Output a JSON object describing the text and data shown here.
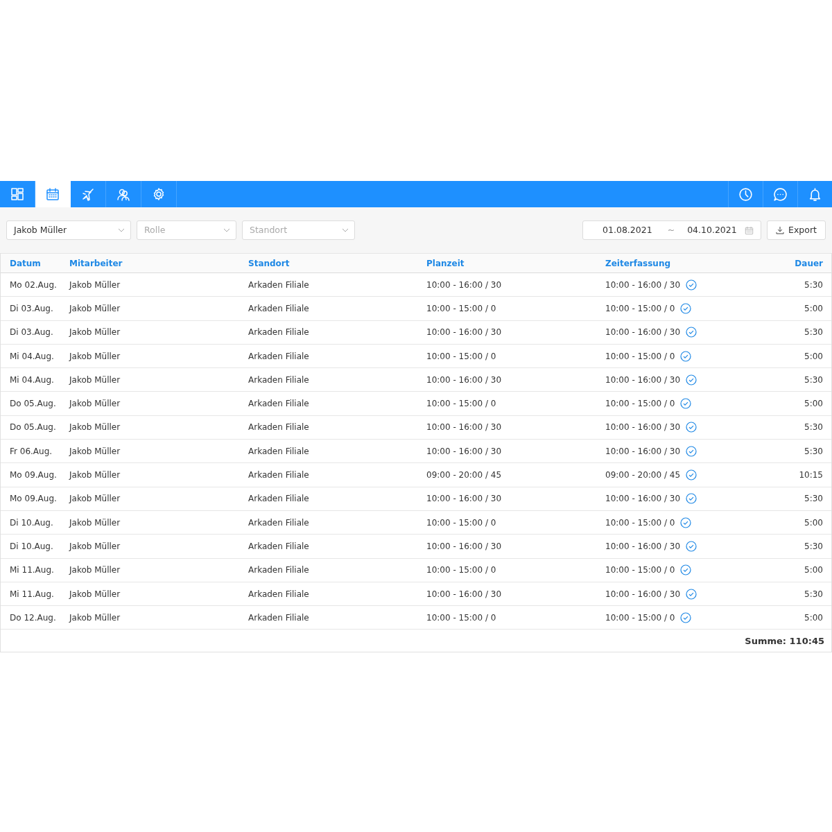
{
  "nav": {
    "left_tabs": [
      {
        "kind": "dashboard",
        "selected": false
      },
      {
        "kind": "calendar",
        "selected": true
      },
      {
        "kind": "plane",
        "selected": false
      },
      {
        "kind": "users",
        "selected": false
      },
      {
        "kind": "settings",
        "selected": false
      }
    ],
    "right_tabs": [
      {
        "kind": "clock"
      },
      {
        "kind": "chat"
      },
      {
        "kind": "bell"
      }
    ]
  },
  "filters": [
    {
      "value": "Jakob Müller"
    },
    {
      "placeholder": "Rolle"
    },
    {
      "placeholder": "Standort"
    }
  ],
  "date_range": {
    "from": "01.08.2021",
    "separator": "~",
    "to": "04.10.2021"
  },
  "export_button": "Export",
  "table": {
    "columns": [
      "Datum",
      "Mitarbeiter",
      "Standort",
      "Planzeit",
      "Zeiterfassung",
      "Dauer"
    ],
    "rows": [
      {
        "datum": "Mo 02.Aug.",
        "mitarbeiter": "Jakob Müller",
        "standort": "Arkaden Filiale",
        "planzeit": "10:00 - 16:00 / 30",
        "zeiterfassung": "10:00 - 16:00 / 30",
        "confirmed": true,
        "dauer": "5:30"
      },
      {
        "datum": "Di 03.Aug.",
        "mitarbeiter": "Jakob Müller",
        "standort": "Arkaden Filiale",
        "planzeit": "10:00 - 15:00 / 0",
        "zeiterfassung": "10:00 - 15:00 / 0",
        "confirmed": true,
        "dauer": "5:00"
      },
      {
        "datum": "Di 03.Aug.",
        "mitarbeiter": "Jakob Müller",
        "standort": "Arkaden Filiale",
        "planzeit": "10:00 - 16:00 / 30",
        "zeiterfassung": "10:00 - 16:00 / 30",
        "confirmed": true,
        "dauer": "5:30"
      },
      {
        "datum": "Mi 04.Aug.",
        "mitarbeiter": "Jakob Müller",
        "standort": "Arkaden Filiale",
        "planzeit": "10:00 - 15:00 / 0",
        "zeiterfassung": "10:00 - 15:00 / 0",
        "confirmed": true,
        "dauer": "5:00"
      },
      {
        "datum": "Mi 04.Aug.",
        "mitarbeiter": "Jakob Müller",
        "standort": "Arkaden Filiale",
        "planzeit": "10:00 - 16:00 / 30",
        "zeiterfassung": "10:00 - 16:00 / 30",
        "confirmed": true,
        "dauer": "5:30"
      },
      {
        "datum": "Do 05.Aug.",
        "mitarbeiter": "Jakob Müller",
        "standort": "Arkaden Filiale",
        "planzeit": "10:00 - 15:00 / 0",
        "zeiterfassung": "10:00 - 15:00 / 0",
        "confirmed": true,
        "dauer": "5:00"
      },
      {
        "datum": "Do 05.Aug.",
        "mitarbeiter": "Jakob Müller",
        "standort": "Arkaden Filiale",
        "planzeit": "10:00 - 16:00 / 30",
        "zeiterfassung": "10:00 - 16:00 / 30",
        "confirmed": true,
        "dauer": "5:30"
      },
      {
        "datum": "Fr 06.Aug.",
        "mitarbeiter": "Jakob Müller",
        "standort": "Arkaden Filiale",
        "planzeit": "10:00 - 16:00 / 30",
        "zeiterfassung": "10:00 - 16:00 / 30",
        "confirmed": true,
        "dauer": "5:30"
      },
      {
        "datum": "Mo 09.Aug.",
        "mitarbeiter": "Jakob Müller",
        "standort": "Arkaden Filiale",
        "planzeit": "09:00 - 20:00 / 45",
        "zeiterfassung": "09:00 - 20:00 / 45",
        "confirmed": true,
        "dauer": "10:15"
      },
      {
        "datum": "Mo 09.Aug.",
        "mitarbeiter": "Jakob Müller",
        "standort": "Arkaden Filiale",
        "planzeit": "10:00 - 16:00 / 30",
        "zeiterfassung": "10:00 - 16:00 / 30",
        "confirmed": true,
        "dauer": "5:30"
      },
      {
        "datum": "Di 10.Aug.",
        "mitarbeiter": "Jakob Müller",
        "standort": "Arkaden Filiale",
        "planzeit": "10:00 - 15:00 / 0",
        "zeiterfassung": "10:00 - 15:00 / 0",
        "confirmed": true,
        "dauer": "5:00"
      },
      {
        "datum": "Di 10.Aug.",
        "mitarbeiter": "Jakob Müller",
        "standort": "Arkaden Filiale",
        "planzeit": "10:00 - 16:00 / 30",
        "zeiterfassung": "10:00 - 16:00 / 30",
        "confirmed": true,
        "dauer": "5:30"
      },
      {
        "datum": "Mi 11.Aug.",
        "mitarbeiter": "Jakob Müller",
        "standort": "Arkaden Filiale",
        "planzeit": "10:00 - 15:00 / 0",
        "zeiterfassung": "10:00 - 15:00 / 0",
        "confirmed": true,
        "dauer": "5:00"
      },
      {
        "datum": "Mi 11.Aug.",
        "mitarbeiter": "Jakob Müller",
        "standort": "Arkaden Filiale",
        "planzeit": "10:00 - 16:00 / 30",
        "zeiterfassung": "10:00 - 16:00 / 30",
        "confirmed": true,
        "dauer": "5:30"
      },
      {
        "datum": "Do 12.Aug.",
        "mitarbeiter": "Jakob Müller",
        "standort": "Arkaden Filiale",
        "planzeit": "10:00 - 15:00 / 0",
        "zeiterfassung": "10:00 - 15:00 / 0",
        "confirmed": true,
        "dauer": "5:00"
      }
    ],
    "total": "Summe: 110:45"
  }
}
